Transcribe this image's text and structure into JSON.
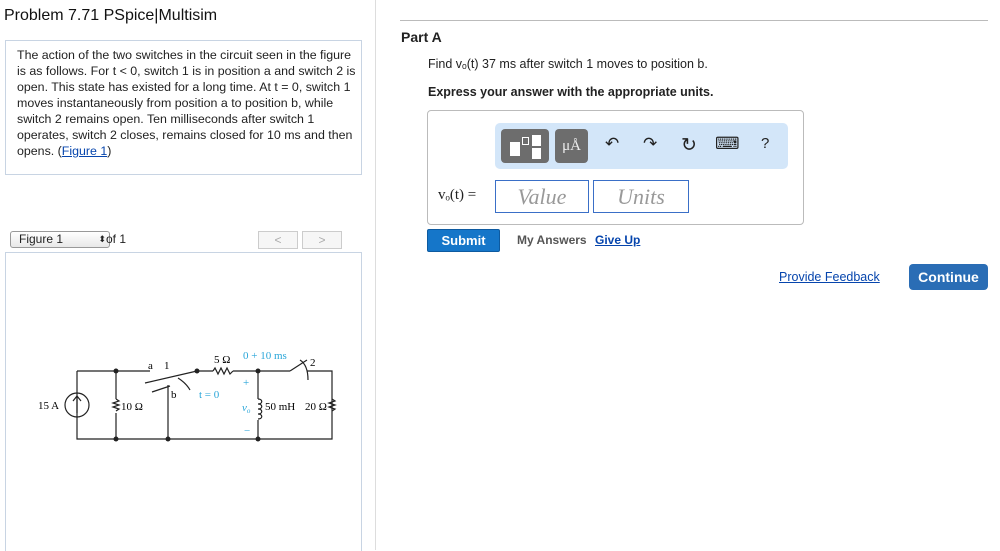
{
  "title": "Problem 7.71 PSpice|Multisim",
  "description": {
    "text": "The action of the two switches in the circuit seen in the figure is as follows. For t < 0, switch 1 is in position a and switch 2 is open. This state has existed for a long time. At t = 0, switch 1 moves instantaneously from position a to position b, while switch 2 remains open. Ten milliseconds after switch 1 operates, switch 2 closes, remains closed for 10 ms and then opens. (",
    "link": "Figure 1",
    "end": ")"
  },
  "figure_nav": {
    "selected": "Figure 1",
    "of": "of 1",
    "prev": "<",
    "next": ">"
  },
  "circuit": {
    "source": "15 A",
    "r1": "10 Ω",
    "a": "a",
    "b": "b",
    "sw1": "1",
    "t0": "t = 0",
    "r2": "5 Ω",
    "sw2_time": "0 + 10 ms",
    "sw2": "2",
    "plus": "+",
    "minus": "−",
    "vo": "v",
    "vo_sub": "o",
    "inductor": "50 mH",
    "r3": "20 Ω"
  },
  "part": {
    "label": "Part A",
    "question": "Find vₒ(t) 37 ms after switch 1 moves to position b.",
    "instruction": "Express your answer with the appropriate units.",
    "answer_label": "vₒ(t) =",
    "value_placeholder": "Value",
    "units_placeholder": "Units",
    "toolbar": {
      "units_button": "μÅ",
      "undo": "↶",
      "redo": "↷",
      "reset": "↻",
      "keyboard": "⌨",
      "help": "?"
    },
    "submit": "Submit",
    "my_answers": "My Answers",
    "give_up": "Give Up"
  },
  "footer": {
    "feedback": "Provide Feedback",
    "continue": "Continue"
  }
}
